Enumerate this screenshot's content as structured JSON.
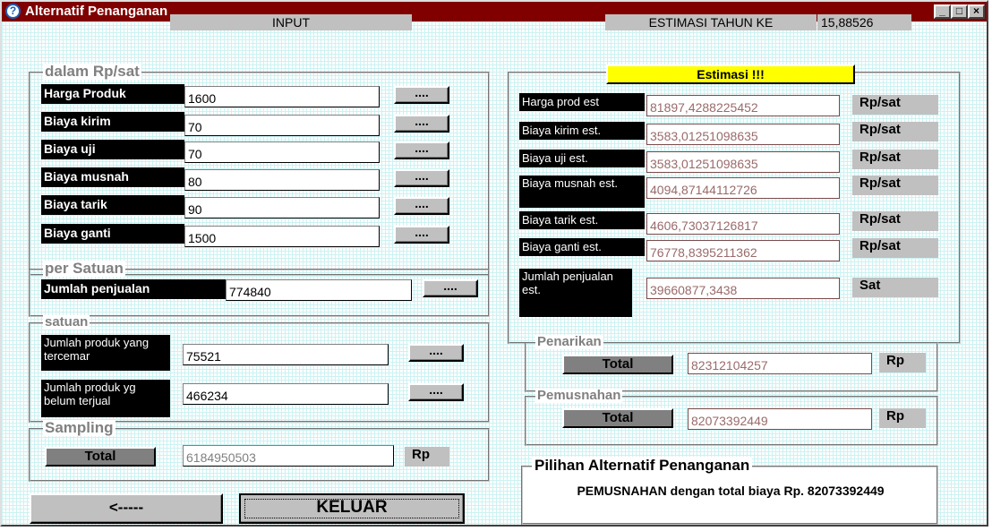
{
  "window": {
    "title": "Alternatif Penanganan",
    "icon": "help-icon",
    "controls": [
      "minimize",
      "maximize",
      "close"
    ]
  },
  "header": {
    "input_label": "INPUT",
    "estimasi_label": "ESTIMASI TAHUN KE",
    "tahun_value": "15,88526"
  },
  "rp_sat": {
    "legend": "dalam Rp/sat",
    "rows": [
      {
        "label": "Harga Produk",
        "value": "1600",
        "button": "...."
      },
      {
        "label": "Biaya kirim",
        "value": "70",
        "button": "...."
      },
      {
        "label": "Biaya uji",
        "value": "70",
        "button": "...."
      },
      {
        "label": "Biaya musnah",
        "value": "80",
        "button": "...."
      },
      {
        "label": "Biaya tarik",
        "value": "90",
        "button": "...."
      },
      {
        "label": "Biaya ganti",
        "value": "1500",
        "button": "...."
      }
    ]
  },
  "per_satuan": {
    "legend": "per Satuan",
    "label": "Jumlah penjualan",
    "value": "774840",
    "button": "...."
  },
  "satuan": {
    "legend": "satuan",
    "rows": [
      {
        "label": "Jumlah produk yang tercemar",
        "value": "75521",
        "button": "...."
      },
      {
        "label": "Jumlah produk yg belum terjual",
        "value": "466234",
        "button": "...."
      }
    ]
  },
  "sampling": {
    "legend": "Sampling",
    "button": "Total",
    "value": "6184950503",
    "unit": "Rp"
  },
  "footer": {
    "back_label": "<-----",
    "exit_label": "KELUAR"
  },
  "estimasi": {
    "title": "Estimasi !!!",
    "rows": [
      {
        "label": "Harga prod est",
        "value": "81897,4288225452",
        "unit": "Rp/sat"
      },
      {
        "label": "Biaya kirim est.",
        "value": "3583,01251098635",
        "unit": "Rp/sat"
      },
      {
        "label": "Biaya uji est.",
        "value": "3583,01251098635",
        "unit": "Rp/sat"
      },
      {
        "label": "Biaya musnah est.",
        "value": "4094,87144112726",
        "unit": "Rp/sat"
      },
      {
        "label": "Biaya tarik est.",
        "value": "4606,73037126817",
        "unit": "Rp/sat"
      },
      {
        "label": "Biaya ganti est.",
        "value": "76778,8395211362",
        "unit": "Rp/sat"
      },
      {
        "label": "Jumlah penjualan est.",
        "value": "39660877,3438",
        "unit": "Sat"
      }
    ]
  },
  "penarikan": {
    "legend": "Penarikan",
    "button": "Total",
    "value": "82312104257",
    "unit": "Rp"
  },
  "pemusnahan": {
    "legend": "Pemusnahan",
    "button": "Total",
    "value": "82073392449",
    "unit": "Rp"
  },
  "pilihan": {
    "legend": "Pilihan Alternatif Penanganan",
    "text": "PEMUSNAHAN dengan total biaya Rp. 82073392449"
  }
}
